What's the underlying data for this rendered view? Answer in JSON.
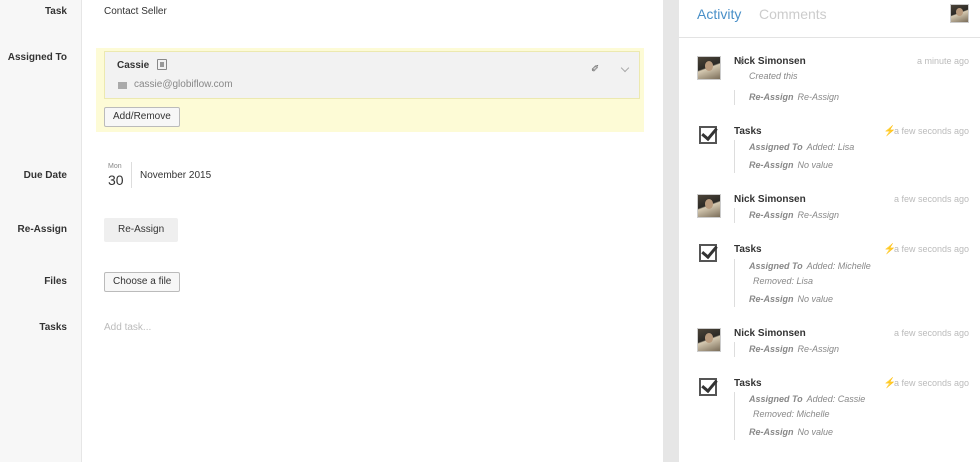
{
  "form": {
    "labels": {
      "task": "Task",
      "assigned_to": "Assigned To",
      "due_date": "Due Date",
      "reassign": "Re-Assign",
      "files": "Files",
      "tasks": "Tasks"
    },
    "task_value": "Contact Seller",
    "assignee": {
      "name": "Cassie",
      "email": "cassie@globiflow.com"
    },
    "add_remove_label": "Add/Remove",
    "due_date": {
      "weekday": "Mon",
      "day": "30",
      "month_year": "November 2015"
    },
    "reassign_button": "Re-Assign",
    "choose_file_button": "Choose a file",
    "add_task_placeholder": "Add task..."
  },
  "panel": {
    "tabs": {
      "activity": "Activity",
      "comments": "Comments"
    },
    "entries": [
      {
        "name": "Nick Simonsen",
        "time": "a minute ago",
        "sub": "Created this",
        "details": [
          {
            "label": "Re-Assign",
            "value": "Re-Assign"
          }
        ]
      },
      {
        "name": "Tasks",
        "time": "a few seconds ago",
        "details": [
          {
            "label": "Assigned To",
            "value": "Added: Lisa"
          },
          {
            "label": "Re-Assign",
            "value": "No value"
          }
        ]
      },
      {
        "name": "Nick Simonsen",
        "time": "a few seconds ago",
        "details": [
          {
            "label": "Re-Assign",
            "value": "Re-Assign"
          }
        ]
      },
      {
        "name": "Tasks",
        "time": "a few seconds ago",
        "details": [
          {
            "label": "Assigned To",
            "value": "Added: Michelle"
          },
          {
            "label": "",
            "value": "Removed: Lisa"
          },
          {
            "label": "Re-Assign",
            "value": "No value"
          }
        ]
      },
      {
        "name": "Nick Simonsen",
        "time": "a few seconds ago",
        "details": [
          {
            "label": "Re-Assign",
            "value": "Re-Assign"
          }
        ]
      },
      {
        "name": "Tasks",
        "time": "a few seconds ago",
        "details": [
          {
            "label": "Assigned To",
            "value": "Added: Cassie"
          },
          {
            "label": "",
            "value": "Removed: Michelle"
          },
          {
            "label": "Re-Assign",
            "value": "No value"
          }
        ]
      }
    ]
  },
  "icons": {
    "address_book": "address-book-icon",
    "envelope": "envelope-icon",
    "pin": "pin-icon",
    "chevron": "chevron-down-icon",
    "checkbox": "task-check-icon",
    "lightning": "lightning-icon",
    "sun": "sun-icon"
  },
  "colors": {
    "accent": "#4a90c8",
    "highlight": "#fdfbd6",
    "divider": "#e6e6e6"
  }
}
